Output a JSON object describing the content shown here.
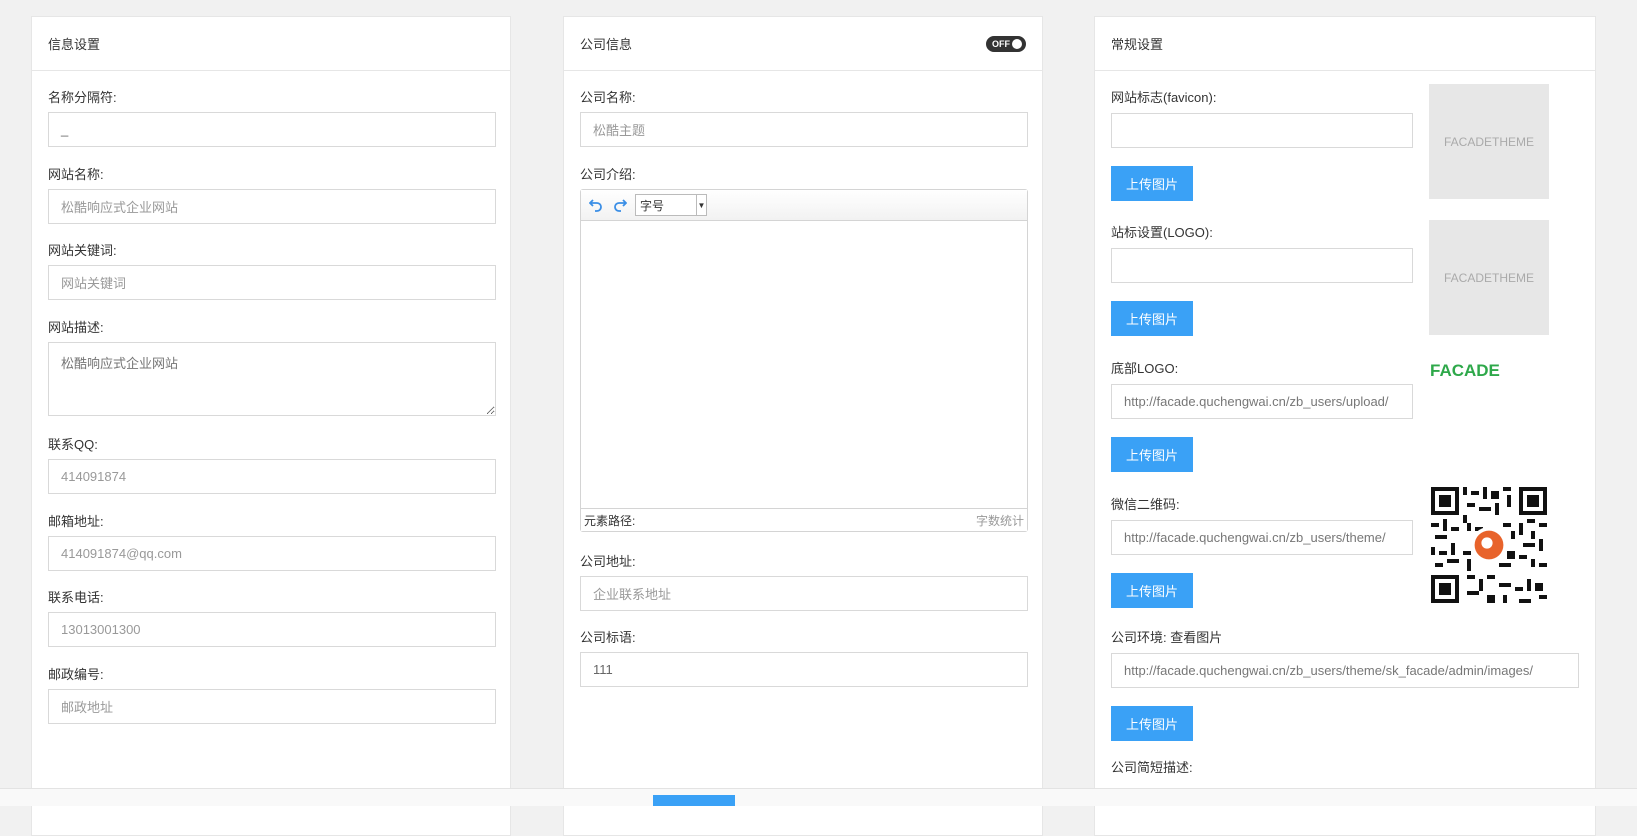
{
  "info_panel": {
    "title": "信息设置",
    "fields": [
      {
        "label": "名称分隔符:",
        "value": "_"
      },
      {
        "label": "网站名称:",
        "placeholder": "松酷响应式企业网站"
      },
      {
        "label": "网站关键词:",
        "placeholder": "网站关键词"
      },
      {
        "label": "网站描述:",
        "placeholder": "松酷响应式企业网站"
      },
      {
        "label": "联系QQ:",
        "placeholder": "414091874"
      },
      {
        "label": "邮箱地址:",
        "placeholder": "414091874@qq.com"
      },
      {
        "label": "联系电话:",
        "placeholder": "13013001300"
      },
      {
        "label": "邮政编号:",
        "placeholder": "邮政地址"
      }
    ]
  },
  "company_panel": {
    "title": "公司信息",
    "toggle_label": "OFF",
    "name_label": "公司名称:",
    "name_placeholder": "松酷主题",
    "intro_label": "公司介绍:",
    "editor": {
      "font_size_label": "字号",
      "path_label": "元素路径:",
      "word_count_label": "字数统计"
    },
    "address_label": "公司地址:",
    "address_placeholder": "企业联系地址",
    "slogan_label": "公司标语:",
    "slogan_value": "111"
  },
  "general_panel": {
    "title": "常规设置",
    "upload_label": "上传图片",
    "favicon_label": "网站标志(favicon):",
    "favicon_value": "",
    "logo_label": "站标设置(LOGO):",
    "logo_value": "",
    "preview_placeholder": "FACADETHEME",
    "footer_logo_label": "底部LOGO:",
    "footer_logo_value": "http://facade.quchengwai.cn/zb_users/upload/",
    "footer_logo_brand": "FACADE",
    "wechat_label": "微信二维码:",
    "wechat_value": "http://facade.quchengwai.cn/zb_users/theme/",
    "env_label": "公司环境: 查看图片",
    "env_value": "http://facade.quchengwai.cn/zb_users/theme/sk_facade/admin/images/",
    "short_desc_label": "公司简短描述:"
  },
  "colors": {
    "accent": "#3aa1f6",
    "brand_green": "#2ea84a"
  }
}
